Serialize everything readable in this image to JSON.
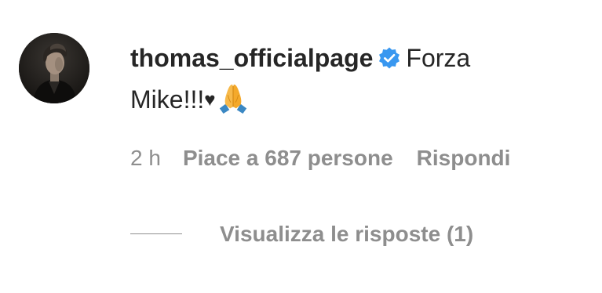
{
  "comment": {
    "username": "thomas_officialpage",
    "verified": true,
    "text_part1": "Forza",
    "text_part2": "Mike!!!",
    "heart": "♥",
    "emoji": "folded-hands-emoji"
  },
  "meta": {
    "time": "2 h",
    "likes": "Piace a 687 persone",
    "reply": "Rispondi"
  },
  "replies": {
    "label": "Visualizza le risposte (1)"
  },
  "colors": {
    "text": "#262626",
    "secondary": "#8e8e8e",
    "verified_blue": "#3897f0"
  }
}
